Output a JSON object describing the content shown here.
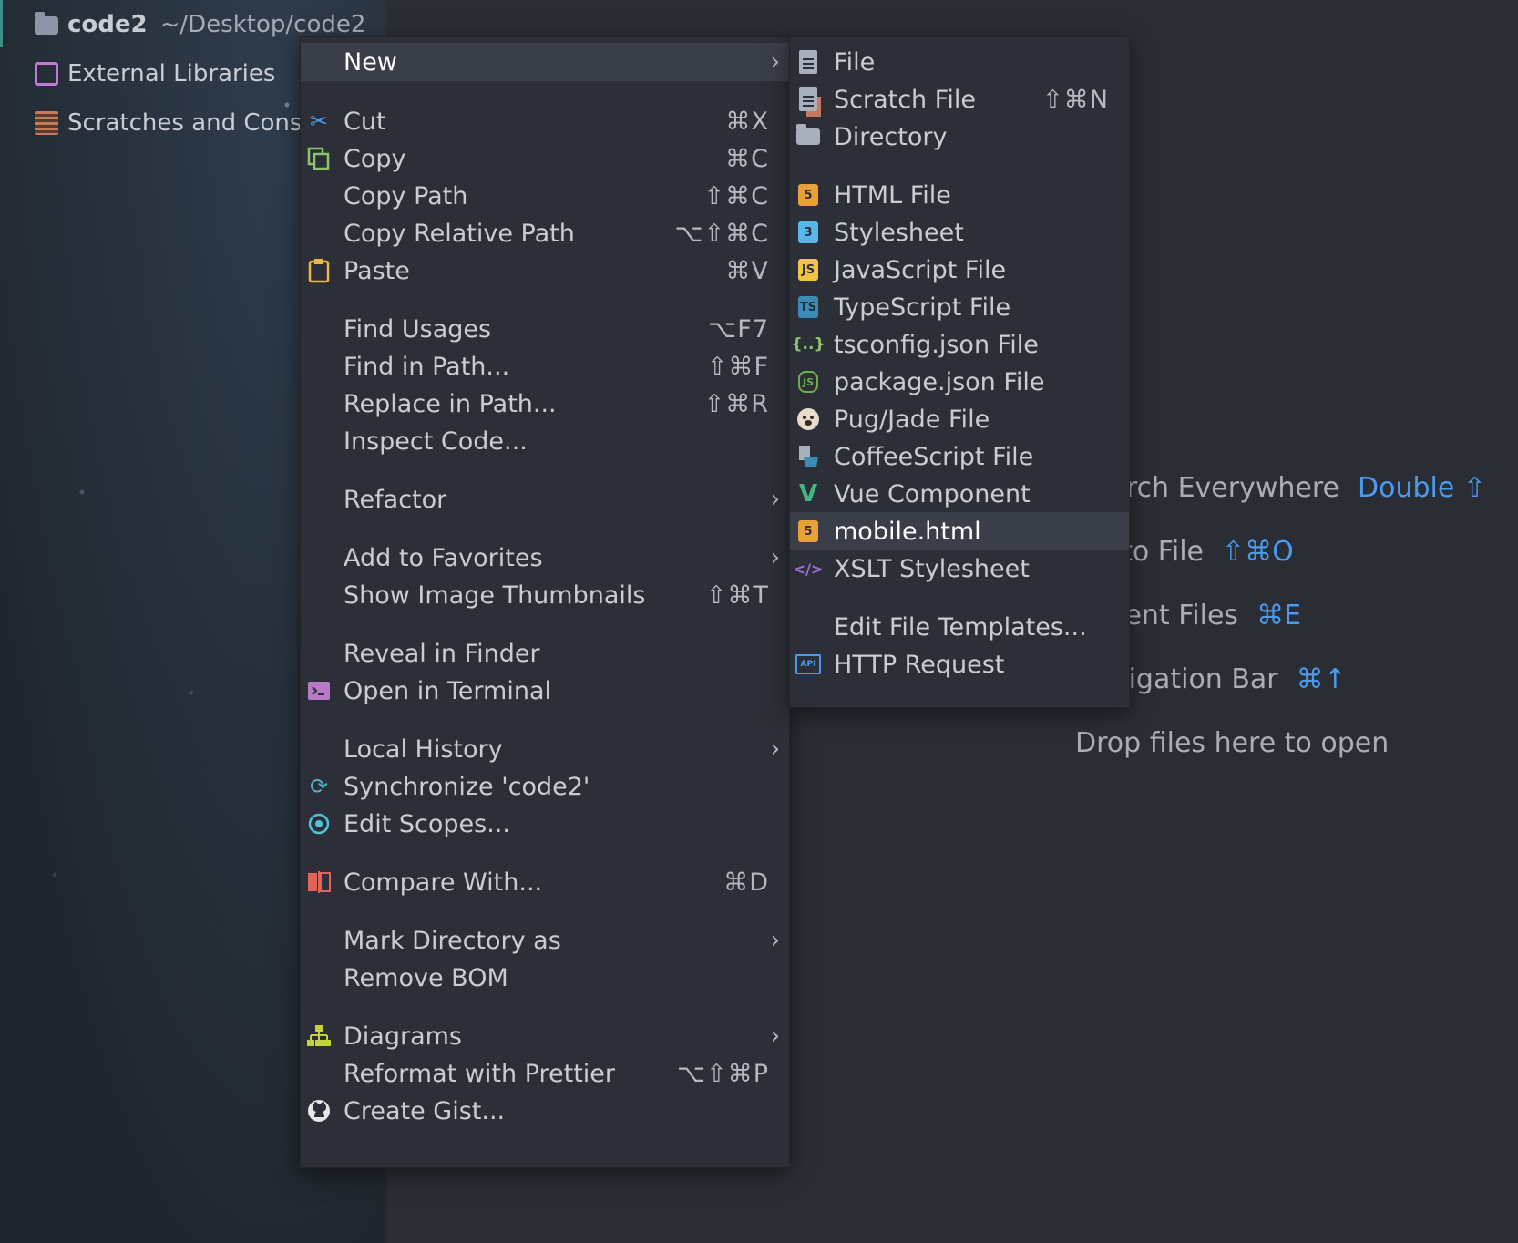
{
  "project": {
    "root_name": "code2",
    "root_path": "~/Desktop/code2",
    "items": [
      {
        "label": "External Libraries"
      },
      {
        "label": "Scratches and Consoles"
      }
    ]
  },
  "hints": {
    "search": {
      "text": "Search Everywhere",
      "key": "Double ⇧"
    },
    "goto_file": {
      "text": "Go to File",
      "key": "⇧⌘O"
    },
    "recent": {
      "text": "Recent Files",
      "key": "⌘E"
    },
    "navbar": {
      "text": "Navigation Bar",
      "key": "⌘↑"
    },
    "drop": "Drop files here to open"
  },
  "context_menu": {
    "new": "New",
    "cut": {
      "label": "Cut",
      "shortcut": "⌘X"
    },
    "copy": {
      "label": "Copy",
      "shortcut": "⌘C"
    },
    "copy_path": {
      "label": "Copy Path",
      "shortcut": "⇧⌘C"
    },
    "copy_relative_path": {
      "label": "Copy Relative Path",
      "shortcut": "⌥⇧⌘C"
    },
    "paste": {
      "label": "Paste",
      "shortcut": "⌘V"
    },
    "find_usages": {
      "label": "Find Usages",
      "shortcut": "⌥F7"
    },
    "find_in_path": {
      "label": "Find in Path...",
      "shortcut": "⇧⌘F"
    },
    "replace_in_path": {
      "label": "Replace in Path...",
      "shortcut": "⇧⌘R"
    },
    "inspect_code": {
      "label": "Inspect Code..."
    },
    "refactor": {
      "label": "Refactor"
    },
    "add_to_favorites": {
      "label": "Add to Favorites"
    },
    "show_image_thumbnails": {
      "label": "Show Image Thumbnails",
      "shortcut": "⇧⌘T"
    },
    "reveal_in_finder": {
      "label": "Reveal in Finder"
    },
    "open_in_terminal": {
      "label": "Open in Terminal"
    },
    "local_history": {
      "label": "Local History"
    },
    "synchronize": {
      "label": "Synchronize 'code2'"
    },
    "edit_scopes": {
      "label": "Edit Scopes..."
    },
    "compare_with": {
      "label": "Compare With...",
      "shortcut": "⌘D"
    },
    "mark_directory_as": {
      "label": "Mark Directory as"
    },
    "remove_bom": {
      "label": "Remove BOM"
    },
    "diagrams": {
      "label": "Diagrams"
    },
    "reformat_prettier": {
      "label": "Reformat with Prettier",
      "shortcut": "⌥⇧⌘P"
    },
    "create_gist": {
      "label": "Create Gist..."
    }
  },
  "new_submenu": {
    "file": "File",
    "scratch_file": {
      "label": "Scratch File",
      "shortcut": "⇧⌘N"
    },
    "directory": "Directory",
    "html_file": "HTML File",
    "stylesheet": "Stylesheet",
    "javascript_file": "JavaScript File",
    "typescript_file": "TypeScript File",
    "tsconfig": "tsconfig.json File",
    "package_json": "package.json File",
    "pug_jade": "Pug/Jade File",
    "coffeescript": "CoffeeScript File",
    "vue_component": "Vue Component",
    "mobile_html": "mobile.html",
    "xslt": "XSLT Stylesheet",
    "edit_templates": "Edit File Templates...",
    "http_request": "HTTP Request"
  },
  "icon_badges": {
    "html": "5",
    "css": "3",
    "js": "JS",
    "ts": "TS",
    "tsconfig": "{..}",
    "node": "JS",
    "vue": "V",
    "xslt": "</>",
    "api": "API"
  },
  "colors": {
    "accent_blue": "#4a9bf0",
    "html_orange": "#e9a03a",
    "css_blue": "#58b6e8",
    "js_yellow": "#f0c542",
    "vue_green": "#41b883"
  }
}
